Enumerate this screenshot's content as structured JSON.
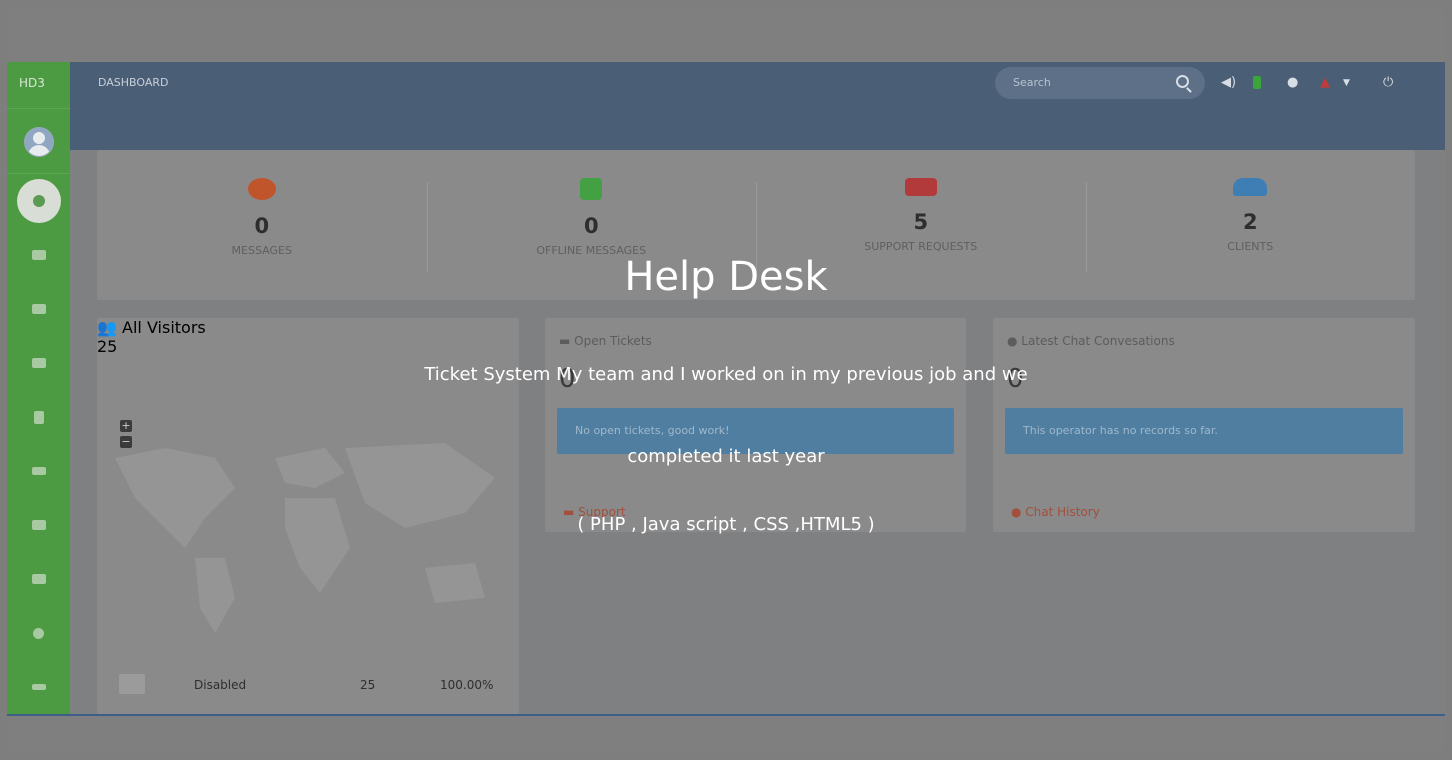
{
  "sidebar": {
    "brand": "HD3"
  },
  "topbar": {
    "title": "DASHBOARD",
    "search_placeholder": "Search"
  },
  "stats": [
    {
      "value": "0",
      "label": "MESSAGES",
      "icon": "chat-bubble-icon",
      "color": "#c0552c"
    },
    {
      "value": "0",
      "label": "OFFLINE MESSAGES",
      "icon": "offline-message-icon",
      "color": "#43a043"
    },
    {
      "value": "5",
      "label": "SUPPORT REQUESTS",
      "icon": "ticket-icon",
      "color": "#b33a3a"
    },
    {
      "value": "2",
      "label": "CLIENTS",
      "icon": "users-icon",
      "color": "#3f7db5"
    }
  ],
  "visitors": {
    "title": "All Visitors",
    "count": "25",
    "row": {
      "status": "Disabled",
      "count": "25",
      "percent": "100.00%"
    }
  },
  "open_tickets": {
    "title": "Open Tickets",
    "count": "0",
    "alert": "No open tickets, good work!",
    "link": "Support"
  },
  "chats": {
    "title": "Latest Chat Convesations",
    "count": "0",
    "alert": "This operator has no records so far.",
    "link": "Chat History"
  },
  "overlay": {
    "title": "Help Desk",
    "line1": "Ticket System My team and I worked on in my previous job and we",
    "line2": "completed it last year",
    "line3": "( PHP , Java script , CSS ,HTML5 )"
  }
}
